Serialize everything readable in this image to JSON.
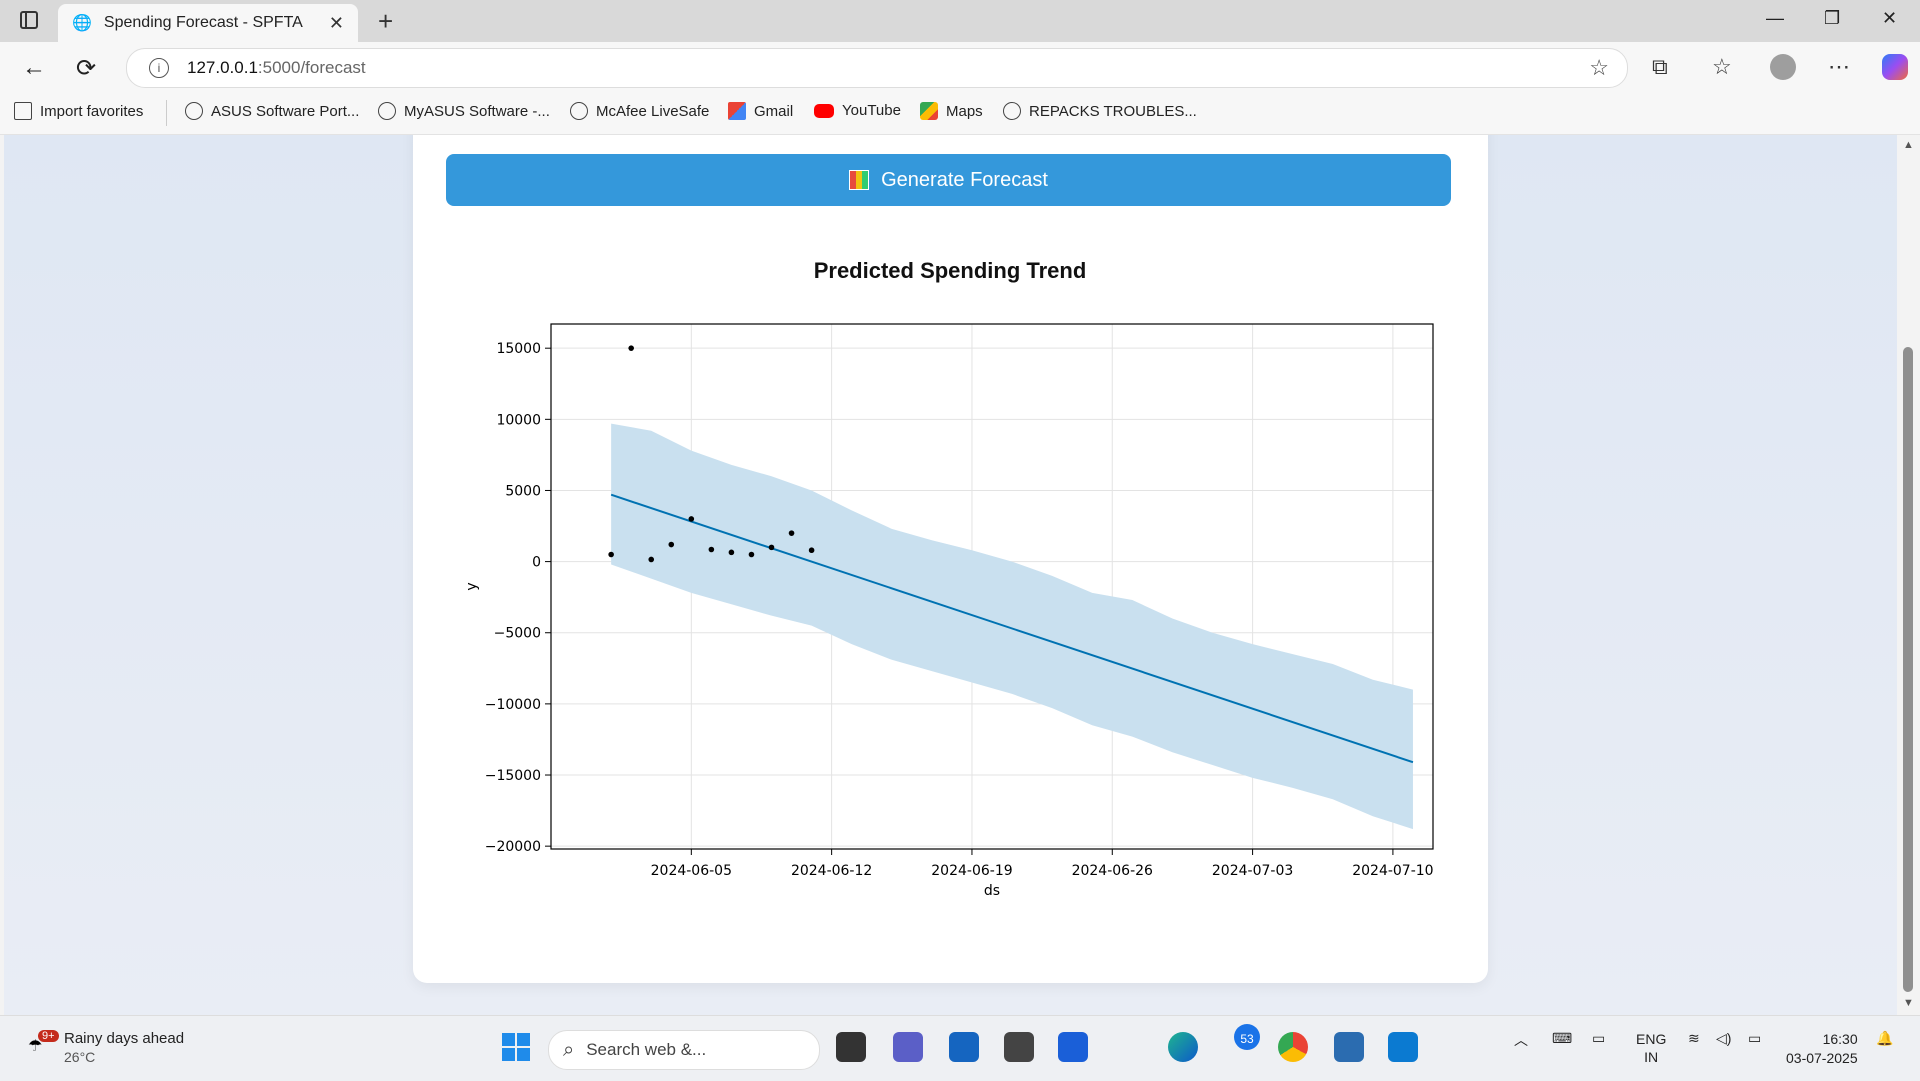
{
  "browser": {
    "tab_title": "Spending Forecast - SPFTA",
    "url_host": "127.0.0.1",
    "url_path": ":5000/forecast",
    "bookmarks": [
      {
        "label": "Import favorites",
        "icon": "folder-icon"
      },
      {
        "label": "ASUS Software Port...",
        "icon": "globe-icon"
      },
      {
        "label": "MyASUS Software -...",
        "icon": "globe-icon"
      },
      {
        "label": "McAfee LiveSafe",
        "icon": "globe-icon"
      },
      {
        "label": "Gmail",
        "icon": "gmail-icon"
      },
      {
        "label": "YouTube",
        "icon": "youtube-icon"
      },
      {
        "label": "Maps",
        "icon": "maps-icon"
      },
      {
        "label": "REPACKS TROUBLES...",
        "icon": "globe-icon"
      }
    ]
  },
  "page": {
    "generate_button_label": "Generate Forecast"
  },
  "chart_data": {
    "type": "line",
    "title": "Predicted Spending Trend",
    "xlabel": "ds",
    "ylabel": "y",
    "x_tick_labels": [
      "2024-06-05",
      "2024-06-12",
      "2024-06-19",
      "2024-06-26",
      "2024-07-03",
      "2024-07-10"
    ],
    "y_tick_labels": [
      "15000",
      "10000",
      "5000",
      "0",
      "−5000",
      "−10000",
      "−15000",
      "−20000"
    ],
    "y_ticks": [
      15000,
      10000,
      5000,
      0,
      -5000,
      -10000,
      -15000,
      -20000
    ],
    "xlim": [
      "2024-05-29",
      "2024-07-12"
    ],
    "ylim": [
      -20200,
      16700
    ],
    "grid": true,
    "colors": {
      "trend": "#0072B2",
      "band": "#c9e0ef",
      "points": "#000000"
    },
    "actuals": [
      {
        "x": "2024-06-01",
        "y": 500
      },
      {
        "x": "2024-06-02",
        "y": 15000
      },
      {
        "x": "2024-06-03",
        "y": 150
      },
      {
        "x": "2024-06-04",
        "y": 1200
      },
      {
        "x": "2024-06-05",
        "y": 3000
      },
      {
        "x": "2024-06-06",
        "y": 850
      },
      {
        "x": "2024-06-07",
        "y": 650
      },
      {
        "x": "2024-06-08",
        "y": 500
      },
      {
        "x": "2024-06-09",
        "y": 1000
      },
      {
        "x": "2024-06-10",
        "y": 2000
      },
      {
        "x": "2024-06-11",
        "y": 800
      }
    ],
    "forecast": {
      "x": [
        "2024-06-01",
        "2024-07-11"
      ],
      "yhat": [
        4700,
        -14100
      ]
    },
    "band": {
      "x": [
        "2024-06-01",
        "2024-06-03",
        "2024-06-05",
        "2024-06-07",
        "2024-06-09",
        "2024-06-11",
        "2024-06-13",
        "2024-06-15",
        "2024-06-17",
        "2024-06-19",
        "2024-06-21",
        "2024-06-23",
        "2024-06-25",
        "2024-06-27",
        "2024-06-29",
        "2024-07-01",
        "2024-07-03",
        "2024-07-05",
        "2024-07-07",
        "2024-07-09",
        "2024-07-11"
      ],
      "upper": [
        9700,
        9200,
        7800,
        6800,
        6000,
        5000,
        3600,
        2300,
        1500,
        800,
        0,
        -1000,
        -2200,
        -2700,
        -4000,
        -5000,
        -5800,
        -6500,
        -7200,
        -8300,
        -9000
      ],
      "lower": [
        -200,
        -1200,
        -2200,
        -3000,
        -3800,
        -4500,
        -5800,
        -6900,
        -7700,
        -8500,
        -9300,
        -10300,
        -11500,
        -12300,
        -13400,
        -14300,
        -15200,
        -15900,
        -16700,
        -17900,
        -18800
      ]
    }
  },
  "taskbar": {
    "weather_text": "Rainy days ahead",
    "weather_temp": "26°C",
    "weather_badge": "9+",
    "search_placeholder": "Search web &...",
    "notif_count": "53",
    "lang_top": "ENG",
    "lang_bottom": "IN",
    "time": "16:30",
    "date": "03-07-2025"
  }
}
